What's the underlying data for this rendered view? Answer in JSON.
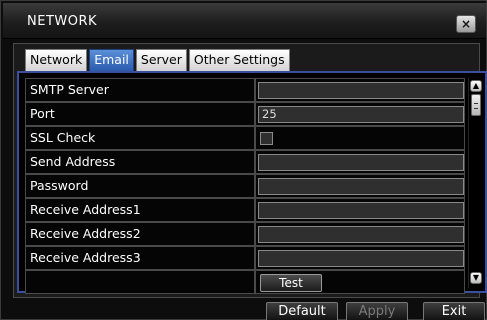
{
  "window": {
    "title": "NETWORK",
    "close_label": "×"
  },
  "tabs": [
    {
      "label": "Network",
      "active": false
    },
    {
      "label": "Email",
      "active": true
    },
    {
      "label": "Server",
      "active": false
    },
    {
      "label": "Other Settings",
      "active": false
    }
  ],
  "email": {
    "rows": [
      {
        "label": "SMTP Server",
        "type": "input",
        "value": ""
      },
      {
        "label": "Port",
        "type": "input",
        "value": "25"
      },
      {
        "label": "SSL Check",
        "type": "checkbox",
        "checked": false
      },
      {
        "label": "Send Address",
        "type": "input",
        "value": ""
      },
      {
        "label": "Password",
        "type": "input",
        "value": ""
      },
      {
        "label": "Receive Address1",
        "type": "input",
        "value": ""
      },
      {
        "label": "Receive Address2",
        "type": "input",
        "value": ""
      },
      {
        "label": "Receive Address3",
        "type": "input",
        "value": ""
      },
      {
        "label": "",
        "type": "button",
        "button_label": "Test"
      }
    ]
  },
  "footer": {
    "default_label": "Default",
    "apply_label": "Apply",
    "exit_label": "Exit"
  },
  "scrollbar": {
    "up_icon": "▲",
    "down_icon": "▼"
  }
}
